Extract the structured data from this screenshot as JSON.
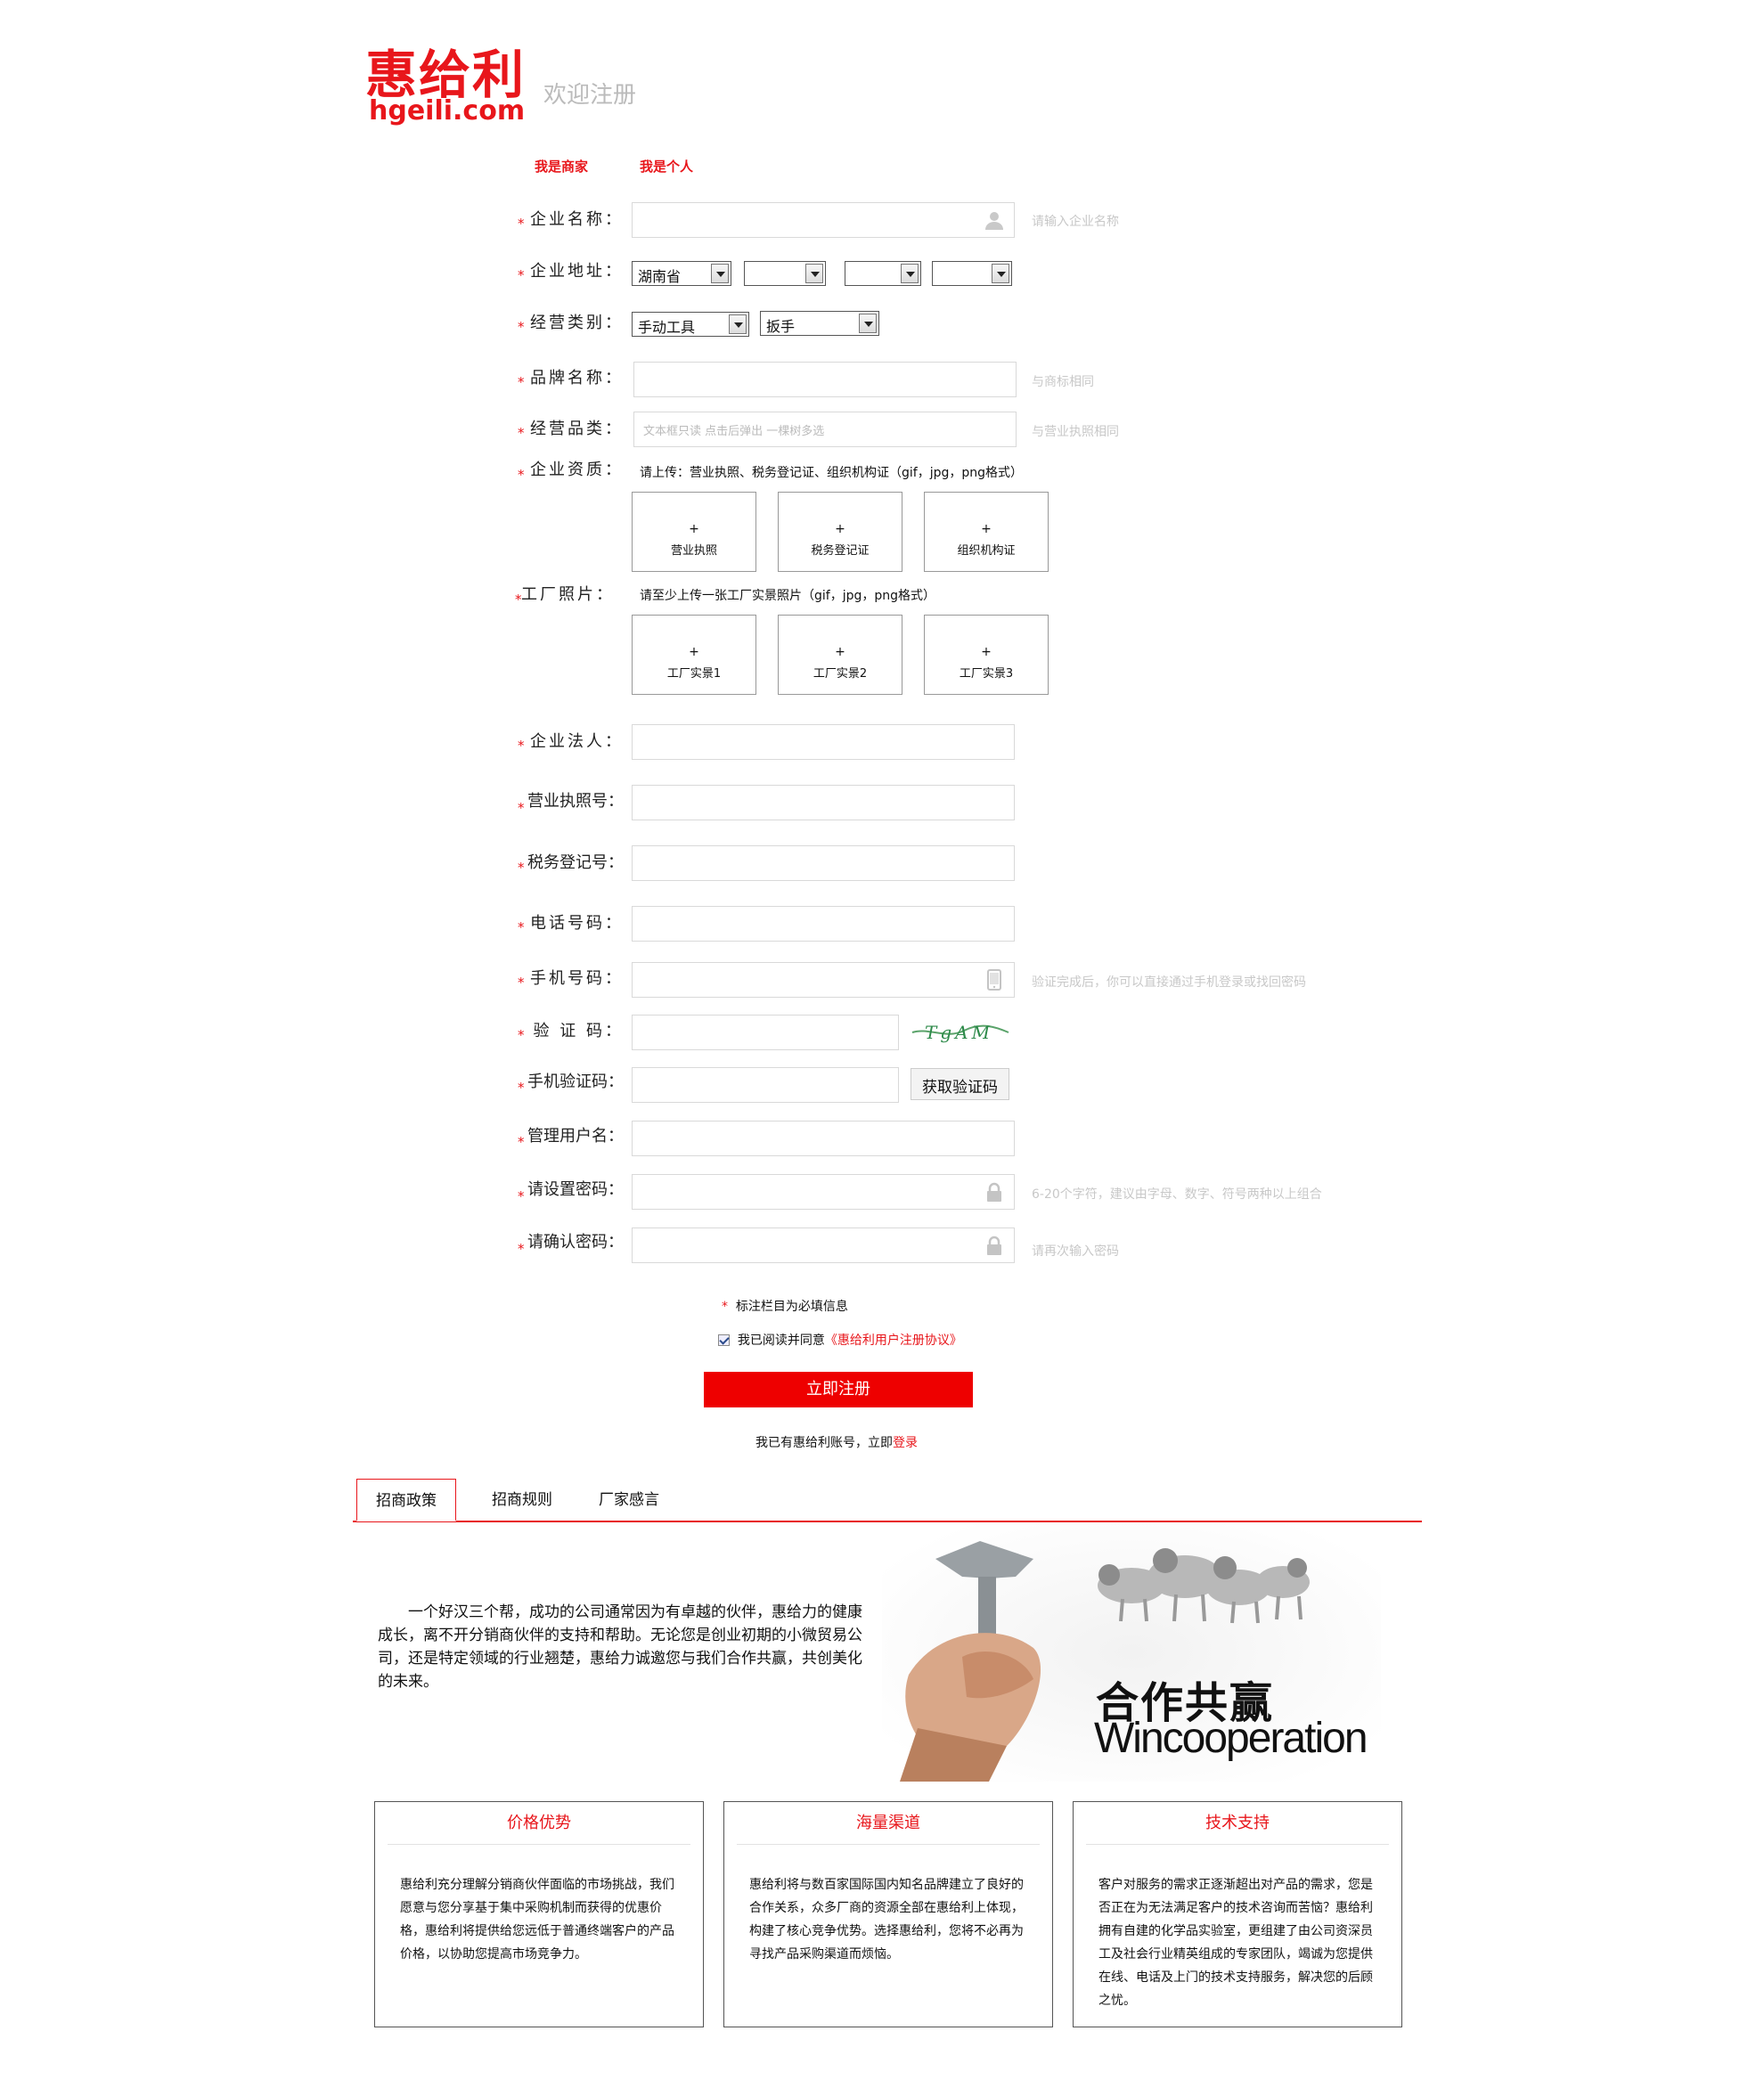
{
  "header": {
    "logo_cn": "惠给利",
    "logo_en": "hgeili.com",
    "welcome": "欢迎注册"
  },
  "roles": {
    "merchant": "我是商家",
    "personal": "我是个人"
  },
  "form": {
    "company_name": {
      "label": "企业名称：",
      "hint": "请输入企业名称"
    },
    "address": {
      "label": "企业地址：",
      "province": "湖南省",
      "city": "",
      "district": "",
      "street": ""
    },
    "category": {
      "label": "经营类别：",
      "main": "手动工具",
      "sub": "扳手"
    },
    "brand": {
      "label": "品牌名称：",
      "hint": "与商标相同"
    },
    "products": {
      "label": "经营品类：",
      "placeholder": "文本框只读 点击后弹出 一棵树多选",
      "hint": "与营业执照相同"
    },
    "qualification": {
      "label": "企业资质：",
      "note": "请上传：营业执照、税务登记证、组织机构证（gif，jpg，png格式）",
      "boxes": [
        "营业执照",
        "税务登记证",
        "组织机构证"
      ]
    },
    "factory_photos": {
      "label": "工厂照片：",
      "note": "请至少上传一张工厂实景照片（gif，jpg，png格式）",
      "boxes": [
        "工厂实景1",
        "工厂实景2",
        "工厂实景3"
      ]
    },
    "legal_person": {
      "label": "企业法人："
    },
    "license_no": {
      "label": "营业执照号："
    },
    "tax_no": {
      "label": "税务登记号："
    },
    "phone": {
      "label": "电话号码："
    },
    "mobile": {
      "label": "手机号码：",
      "hint": "验证完成后，你可以直接通过手机登录或找回密码"
    },
    "captcha": {
      "label": "验 证 码：",
      "image_text": "TgAM"
    },
    "sms_code": {
      "label": "手机验证码：",
      "button": "获取验证码"
    },
    "admin_user": {
      "label": "管理用户名："
    },
    "password": {
      "label": "请设置密码：",
      "hint": "6-20个字符，建议由字母、数字、符号两种以上组合"
    },
    "confirm_password": {
      "label": "请确认密码：",
      "hint": "请再次输入密码"
    },
    "required_note": "标注栏目为必填信息",
    "agree_prefix": "我已阅读并同意",
    "agree_link": "《惠给利用户注册协议》",
    "submit": "立即注册",
    "login_prefix": "我已有惠给利账号，立即",
    "login_link": "登录"
  },
  "tabs": [
    "招商政策",
    "招商规则",
    "厂家感言"
  ],
  "intro": "一个好汉三个帮，成功的公司通常因为有卓越的伙伴，惠给力的健康成长，离不开分销商伙伴的支持和帮助。无论您是创业初期的小微贸易公司，还是特定领域的行业翘楚，惠给力诚邀您与我们合作共赢，共创美化的未来。",
  "banner": {
    "title_cn": "合作共赢",
    "title_en": "Wincooperation"
  },
  "features": [
    {
      "title": "价格优势",
      "desc": "惠给利充分理解分销商伙伴面临的市场挑战，我们愿意与您分享基于集中采购机制而获得的优惠价格，惠给利将提供给您远低于普通终端客户的产品价格，以协助您提高市场竞争力。"
    },
    {
      "title": "海量渠道",
      "desc": "惠给利将与数百家国际国内知名品牌建立了良好的合作关系，众多厂商的资源全部在惠给利上体现，构建了核心竞争优势。选择惠给利，您将不必再为寻找产品采购渠道而烦恼。"
    },
    {
      "title": "技术支持",
      "desc": "客户对服务的需求正逐渐超出对产品的需求，您是否正在为无法满足客户的技术咨询而苦恼？惠给利拥有自建的化学品实验室，更组建了由公司资深员工及社会行业精英组成的专家团队，竭诚为您提供在线、电话及上门的技术支持服务，解决您的后顾之忧。"
    }
  ],
  "colors": {
    "brand_red": "#e8161b",
    "button_red": "#ee0000"
  }
}
